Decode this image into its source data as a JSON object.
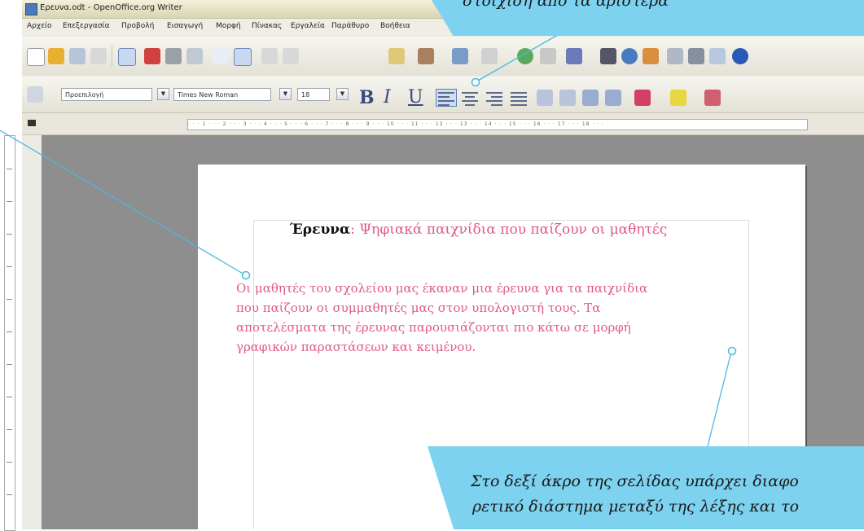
{
  "window": {
    "title": "Ερευνα.odt - OpenOffice.org Writer"
  },
  "menu": [
    "Αρχείο",
    "Επεξεργασία",
    "Προβολή",
    "Εισαγωγή",
    "Μορφή",
    "Πίνακας",
    "Εργαλεία",
    "Παράθυρο",
    "Βοήθεια"
  ],
  "toolbar": {
    "paragraph_style": "Προεπιλογή",
    "font_name": "Times New Roman",
    "font_size": "18",
    "bold": "B",
    "italic": "I",
    "underline": "U"
  },
  "ruler": {
    "horizontal_ticks": "· · · 1 · · · 2 · · · 3 · · · 4 · · · 5 · · · 6 · · · 7 · · · 8 · · · 9 · · · 10 · · · 11 · · · 12 · · · 13 · · · 14 · · · 15 · · · 16 · · · 17 · · · 18 · · ·"
  },
  "document": {
    "title_word": "Έρευνα",
    "title_rest": ": Ψηφιακά παιχνίδια που παίζουν οι μαθητές",
    "body_lines": [
      "Οι μαθητές του σχολείου μας έκαναν μια έρευνα για τα παιχνίδια",
      "που παίζουν οι συμμαθητές μας στον υπολογιστή τους. Τα",
      "αποτελέσματα της έρευνας παρουσιάζονται πιο κάτω σε μορφή",
      "γραφικών παραστάσεων και κειμένου."
    ]
  },
  "callouts": {
    "top": "στοίχιση από τα αριστερά",
    "bottom_line1": "Στο δεξί άκρο της σελίδας υπάρχει διαφο",
    "bottom_line2": "ρετικό διάστημα μεταξύ της λέξης και το"
  },
  "colors": {
    "callout": "#7dd2f0",
    "document_text": "#e05a80",
    "pointer": "#4ab8e0"
  }
}
